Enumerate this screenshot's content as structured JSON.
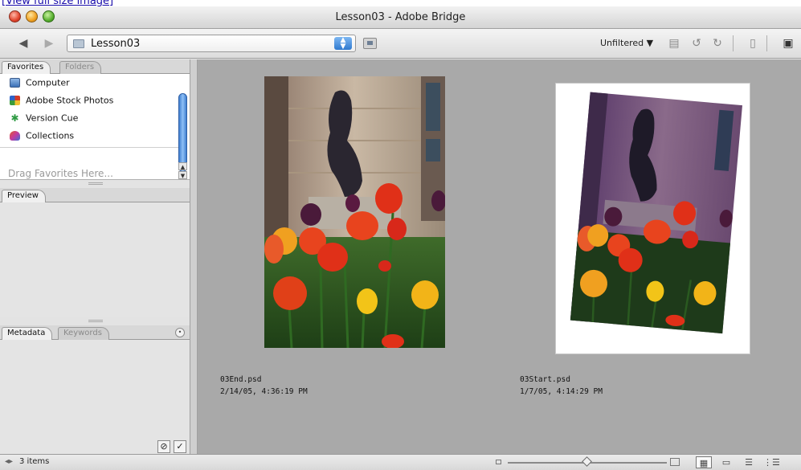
{
  "top_link": "[View full size image]",
  "window": {
    "title": "Lesson03 - Adobe Bridge"
  },
  "toolbar": {
    "path": "Lesson03",
    "filter_label": "Unfiltered ▼",
    "icons": [
      "back-arrow",
      "forward-arrow",
      "folder",
      "path-spinner",
      "go-up-folder",
      "new-folder",
      "rotate-left",
      "rotate-right",
      "trash",
      "compact-mode"
    ]
  },
  "favorites": {
    "tabs": [
      "Favorites",
      "Folders"
    ],
    "items": [
      {
        "label": "Computer",
        "icon": "computer-icon"
      },
      {
        "label": "Adobe Stock Photos",
        "icon": "stock-photos-icon"
      },
      {
        "label": "Version Cue",
        "icon": "version-cue-icon"
      },
      {
        "label": "Collections",
        "icon": "collections-icon"
      }
    ],
    "drag_hint": "Drag Favorites Here..."
  },
  "preview": {
    "tab": "Preview"
  },
  "metadata": {
    "tabs": [
      "Metadata",
      "Keywords"
    ]
  },
  "thumbnails": [
    {
      "filename": "03End.psd",
      "date": "2/14/05, 4:36:19 PM"
    },
    {
      "filename": "03Start.psd",
      "date": "1/7/05, 4:14:29 PM"
    }
  ],
  "statusbar": {
    "item_count": "3 items",
    "thumbnail_size": 0.5
  }
}
